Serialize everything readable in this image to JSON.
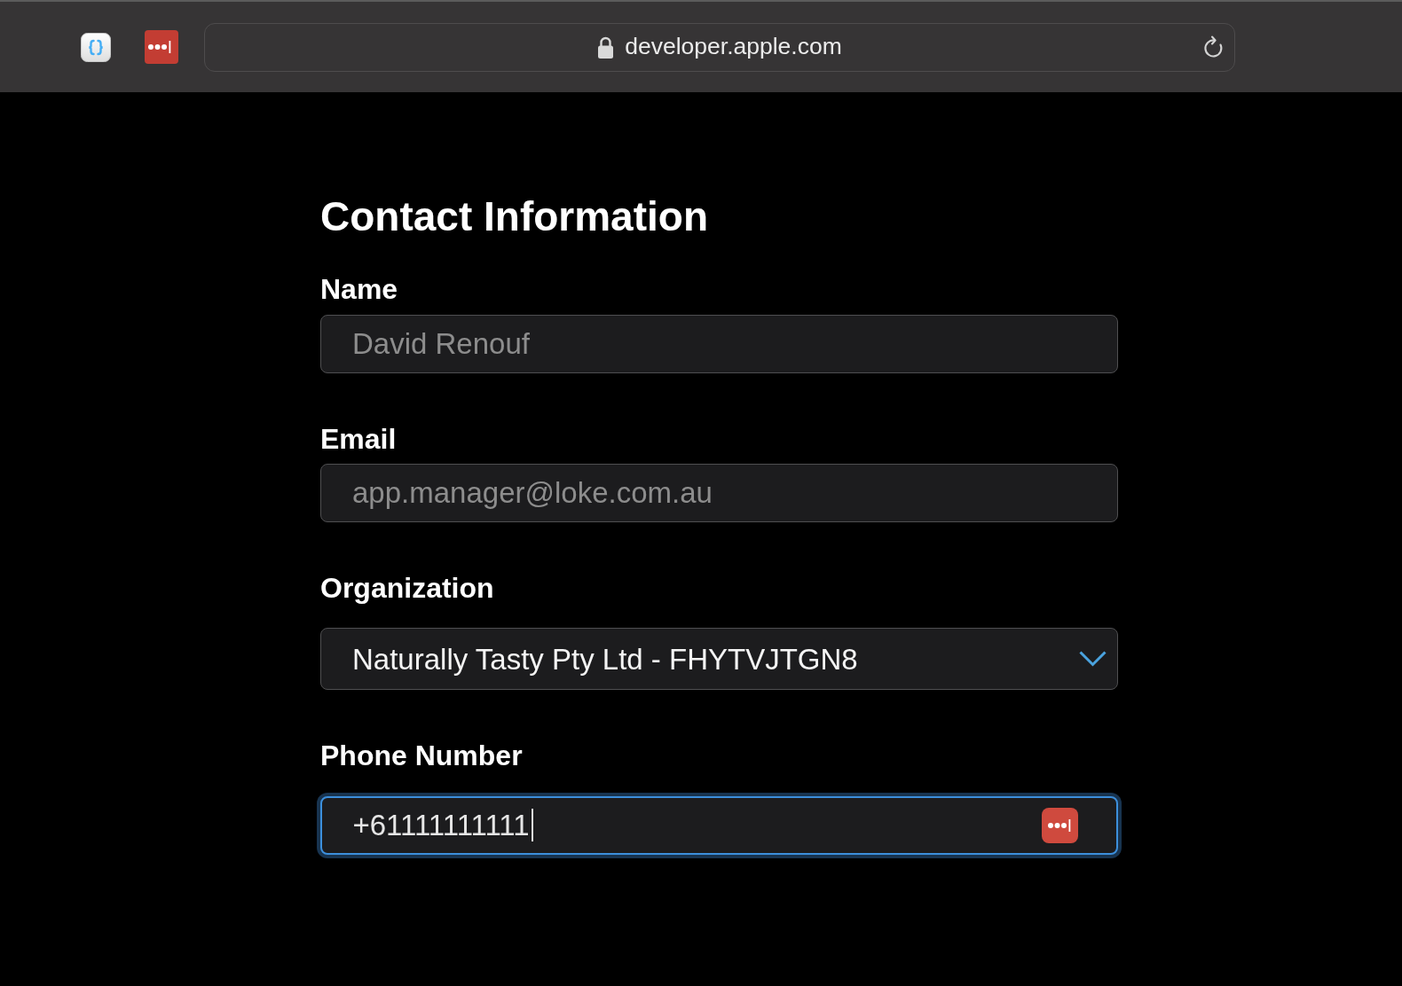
{
  "browser": {
    "toolbar": [
      {
        "kind": "braces"
      },
      {
        "kind": "password"
      }
    ],
    "address": {
      "url": "developer.apple.com",
      "secure": true
    }
  },
  "form": {
    "title": "Contact Information",
    "fields": [
      {
        "kind": "text",
        "label": "Name",
        "value": "David Renouf",
        "disabled": true,
        "focused": false,
        "autofill": false
      },
      {
        "kind": "text",
        "label": "Email",
        "value": "app.manager@loke.com.au",
        "disabled": true,
        "focused": false,
        "autofill": false
      },
      {
        "kind": "select",
        "label": "Organization",
        "value": "Naturally Tasty Pty Ltd - FHYTVJTGN8",
        "disabled": false,
        "focused": false,
        "autofill": false
      },
      {
        "kind": "text",
        "label": "Phone Number",
        "value": "+61111111111",
        "disabled": false,
        "focused": true,
        "autofill": true
      }
    ]
  }
}
